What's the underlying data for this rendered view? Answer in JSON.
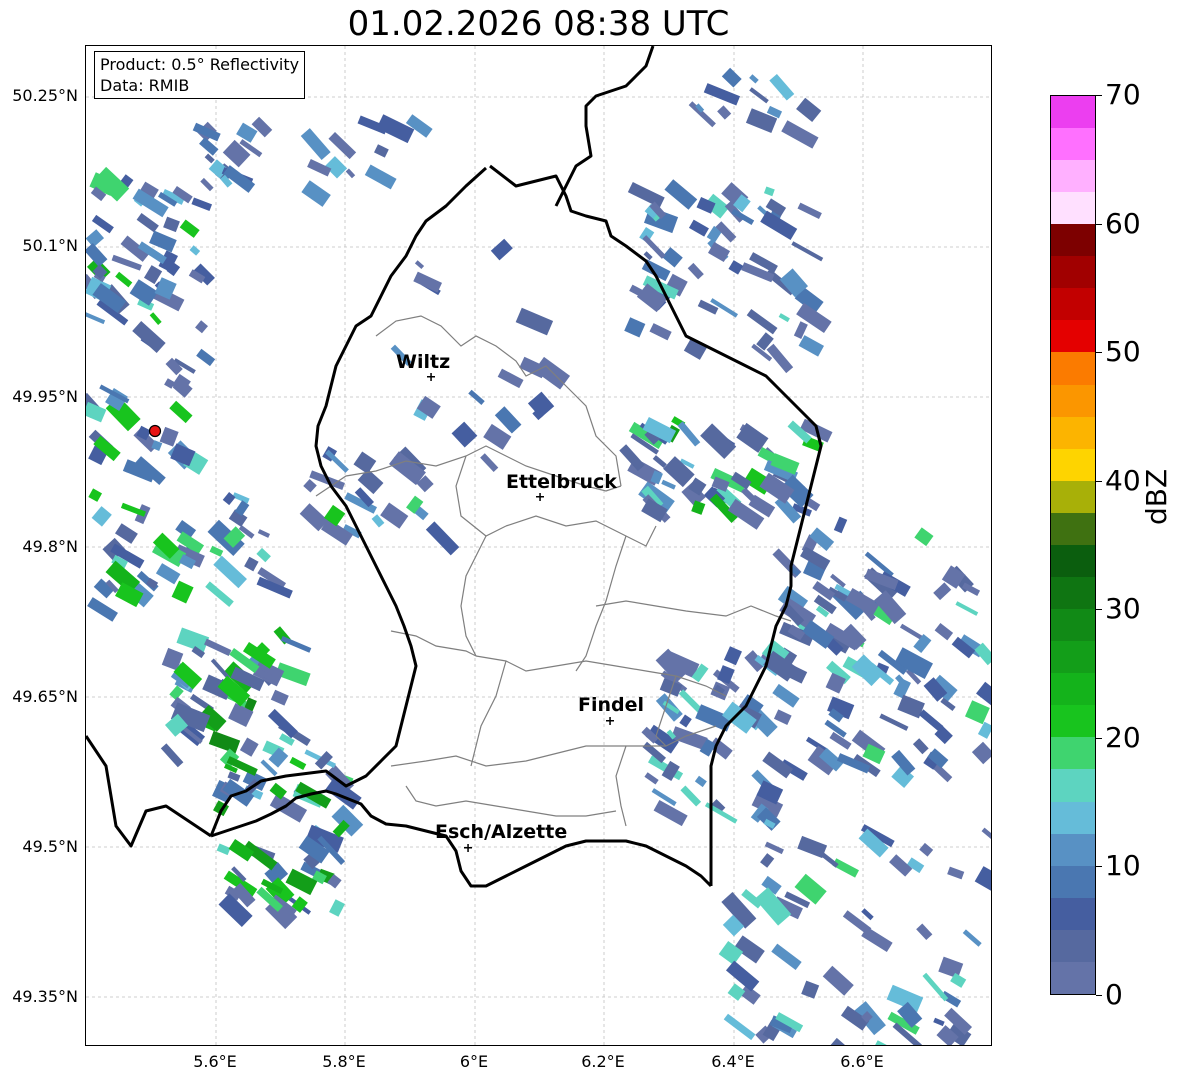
{
  "title": "01.02.2026 08:38 UTC",
  "info": {
    "product": "Product: 0.5° Reflectivity",
    "source": "Data: RMIB"
  },
  "axes": {
    "lat_labels": [
      "50.25°N",
      "50.1°N",
      "49.95°N",
      "49.8°N",
      "49.65°N",
      "49.5°N",
      "49.35°N"
    ],
    "lon_labels": [
      "5.6°E",
      "5.8°E",
      "6°E",
      "6.2°E",
      "6.4°E",
      "6.6°E"
    ]
  },
  "cities": [
    {
      "name": "Wiltz"
    },
    {
      "name": "Ettelbruck"
    },
    {
      "name": "Findel"
    },
    {
      "name": "Esch/Alzette"
    }
  ],
  "colorbar": {
    "label": "dBZ",
    "ticks": [
      "0",
      "10",
      "20",
      "30",
      "40",
      "50",
      "60",
      "70"
    ],
    "colors": [
      "#6473a8",
      "#56699f",
      "#455ea0",
      "#4a77b1",
      "#5891c4",
      "#65bcd9",
      "#5dd4c0",
      "#3fd46f",
      "#18c41e",
      "#14b31b",
      "#139e19",
      "#118a16",
      "#0f7512",
      "#0b5e0e",
      "#3f7111",
      "#a8b008",
      "#fed400",
      "#fcb400",
      "#fb9600",
      "#fb7b00",
      "#e40000",
      "#c20000",
      "#a10000",
      "#7d0000",
      "#ffe0ff",
      "#ffb0ff",
      "#ff70ff",
      "#ec3ef0"
    ]
  },
  "radar_site": {
    "marker_color": "#e81414"
  }
}
